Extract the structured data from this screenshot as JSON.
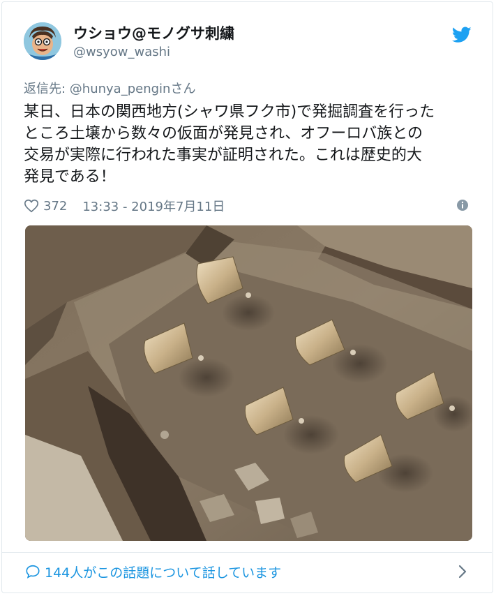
{
  "author": {
    "name": "ウショウ@モノグサ刺繍",
    "handle": "@wsyow_washi"
  },
  "reply": {
    "prefix": "返信先: ",
    "handle": "@hunya_pengin",
    "suffix": "さん"
  },
  "tweet": {
    "lines": [
      "某日、日本の関西地方(シャワ県フク市)で発掘調査を行った",
      "ところ土壌から数々の仮面が発見され、オフーロバ族との",
      "交易が実際に行われた事実が証明された。これは歴史的大",
      "発見である！"
    ]
  },
  "meta": {
    "likes": "372",
    "timestamp": "13:33 - 2019年7月11日"
  },
  "footer": {
    "talking": "144人がこの話題について話しています"
  },
  "icons": {
    "avatar": "avatar-icon",
    "brand": "twitter-bird-icon",
    "like": "heart-icon",
    "info": "info-icon",
    "conversation": "speech-bubble-icon",
    "more": "chevron-right-icon"
  },
  "colors": {
    "text": "#14171a",
    "secondary": "#657786",
    "link": "#1b95e0",
    "brand": "#1da1f2",
    "border": "#e1e8ed"
  }
}
